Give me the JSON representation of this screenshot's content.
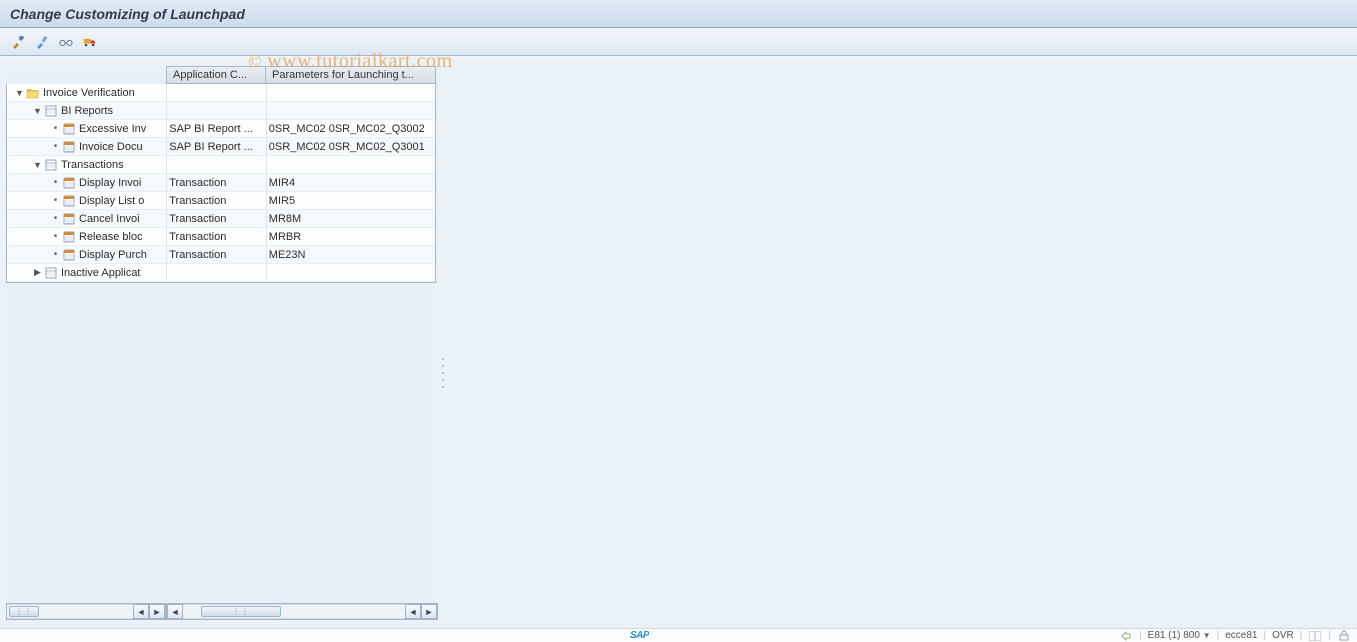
{
  "header": {
    "title": "Change Customizing of Launchpad"
  },
  "toolbar": {
    "buttons": [
      "tool-1",
      "tool-2",
      "tool-3",
      "truck-icon"
    ]
  },
  "watermark": {
    "text": "www.tutorialkart.com",
    "prefix": "© "
  },
  "columns": {
    "col1": "Application C...",
    "col2": "Parameters for Launching t..."
  },
  "tree": [
    {
      "type": "folder-open",
      "indent": 0,
      "twisty": "down",
      "label": "Invoice Verification",
      "c1": "",
      "c2": ""
    },
    {
      "type": "folder-node",
      "indent": 1,
      "twisty": "down",
      "label": "BI Reports",
      "c1": "",
      "c2": ""
    },
    {
      "type": "leaf-report",
      "indent": 2,
      "twisty": "dot",
      "label": "Excessive Inv",
      "c1": "SAP BI Report ...",
      "c2": "0SR_MC02 0SR_MC02_Q3002"
    },
    {
      "type": "leaf-report",
      "indent": 2,
      "twisty": "dot",
      "label": "Invoice Docu",
      "c1": "SAP BI Report ...",
      "c2": "0SR_MC02 0SR_MC02_Q3001"
    },
    {
      "type": "folder-node",
      "indent": 1,
      "twisty": "down",
      "label": "Transactions",
      "c1": "",
      "c2": ""
    },
    {
      "type": "leaf-trans",
      "indent": 2,
      "twisty": "dot",
      "label": "Display Invoi",
      "c1": "Transaction",
      "c2": "MIR4"
    },
    {
      "type": "leaf-trans",
      "indent": 2,
      "twisty": "dot",
      "label": "Display List o",
      "c1": "Transaction",
      "c2": "MIR5"
    },
    {
      "type": "leaf-trans",
      "indent": 2,
      "twisty": "dot",
      "label": "Cancel Invoi",
      "c1": "Transaction",
      "c2": "MR8M"
    },
    {
      "type": "leaf-trans",
      "indent": 2,
      "twisty": "dot",
      "label": "Release bloc",
      "c1": "Transaction",
      "c2": "MRBR"
    },
    {
      "type": "leaf-trans",
      "indent": 2,
      "twisty": "dot",
      "label": "Display Purch",
      "c1": "Transaction",
      "c2": "ME23N"
    },
    {
      "type": "folder-node",
      "indent": 1,
      "twisty": "right",
      "label": "Inactive Applicat",
      "c1": "",
      "c2": ""
    }
  ],
  "statusbar": {
    "sap": "SAP",
    "system": "E81 (1) 800",
    "server": "ecce81",
    "mode": "OVR"
  },
  "colors": {
    "titleGradTop": "#e0ebf5",
    "titleGradBot": "#cbdced",
    "border": "#a8b7c8"
  }
}
